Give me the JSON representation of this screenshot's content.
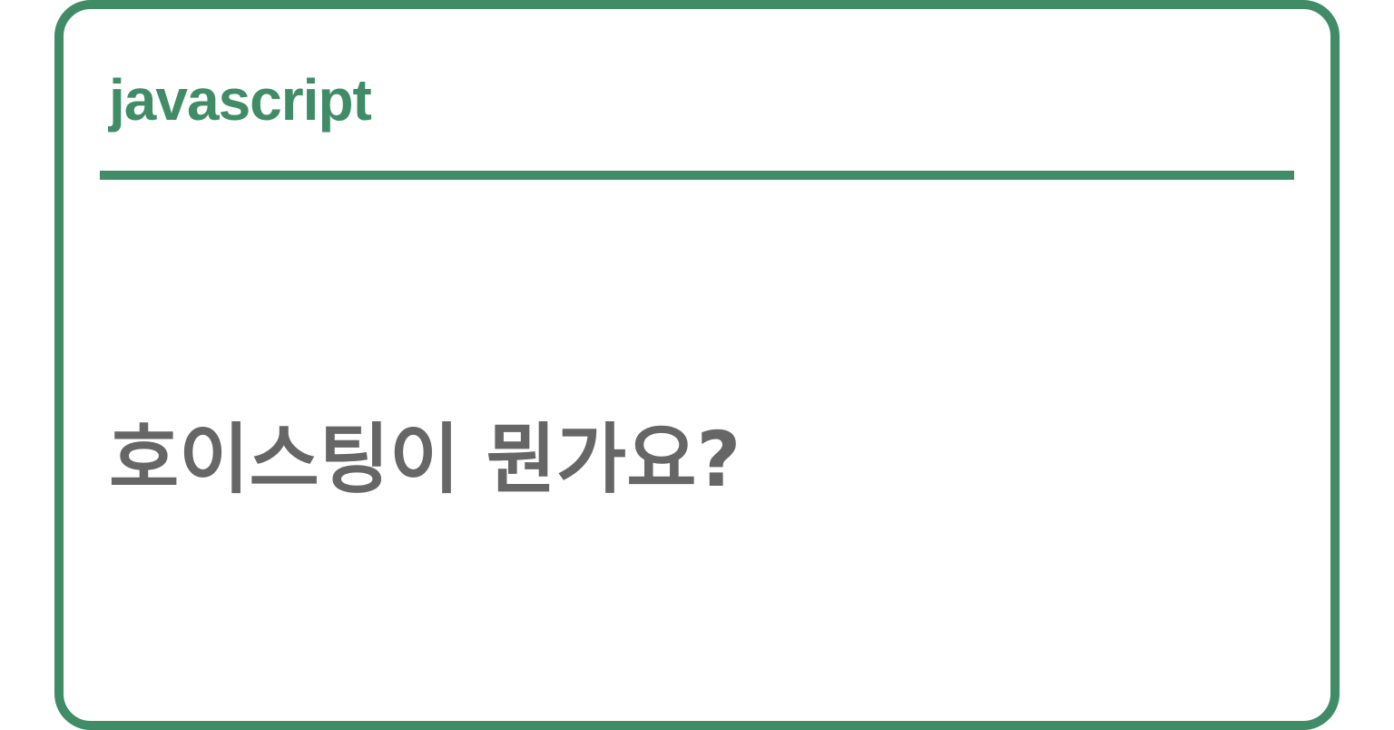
{
  "card": {
    "tag": "javascript",
    "question": "호이스팅이 뭔가요?"
  },
  "colors": {
    "accent": "#408c67",
    "text": "#666666",
    "background": "#ffffff"
  }
}
